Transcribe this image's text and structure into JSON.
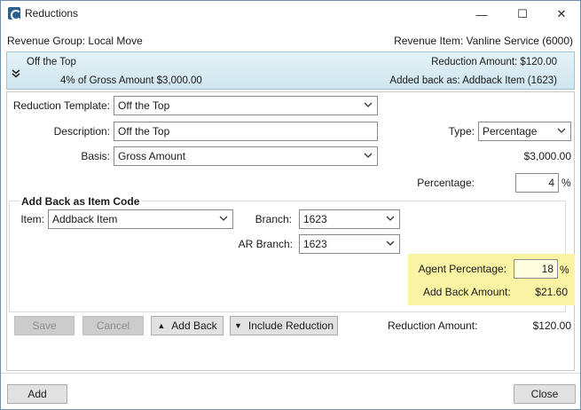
{
  "window": {
    "title": "Reductions"
  },
  "window_controls": {
    "minimize": "—",
    "maximize": "☐",
    "close": "✕"
  },
  "header": {
    "revenue_group": "Revenue Group: Local Move",
    "revenue_item": "Revenue Item: Vanline Service (6000)"
  },
  "banner": {
    "name": "Off the Top",
    "detail": "4% of Gross Amount $3,000.00",
    "reduction_amount": "Reduction Amount: $120.00",
    "added_back_as": "Added back as: Addback Item (1623)"
  },
  "form": {
    "reduction_template_label": "Reduction Template:",
    "reduction_template_value": "Off the Top",
    "description_label": "Description:",
    "description_value": "Off the Top",
    "basis_label": "Basis:",
    "basis_value": "Gross Amount",
    "type_label": "Type:",
    "type_value": "Percentage",
    "gross_amount": "$3,000.00",
    "percentage_label": "Percentage:",
    "percentage_value": "4",
    "percent_sign": "%"
  },
  "add_back": {
    "title": "Add Back as Item Code",
    "item_label": "Item:",
    "item_value": "Addback Item",
    "branch_label": "Branch:",
    "branch_value": "1623",
    "ar_branch_label": "AR Branch:",
    "ar_branch_value": "1623",
    "agent_percentage_label": "Agent Percentage:",
    "agent_percentage_value": "18",
    "percent_sign": "%",
    "add_back_amount_label": "Add Back Amount:",
    "add_back_amount_value": "$21.60"
  },
  "actions": {
    "save": "Save",
    "cancel": "Cancel",
    "add_back": "Add Back",
    "include_reduction": "Include Reduction",
    "reduction_amount_label": "Reduction Amount:",
    "reduction_amount_value": "$120.00"
  },
  "footer": {
    "add": "Add",
    "close": "Close"
  },
  "colors": {
    "banner": "#d8ecf2",
    "highlight": "#fbf3a4",
    "icon": "#2b5f8f"
  }
}
